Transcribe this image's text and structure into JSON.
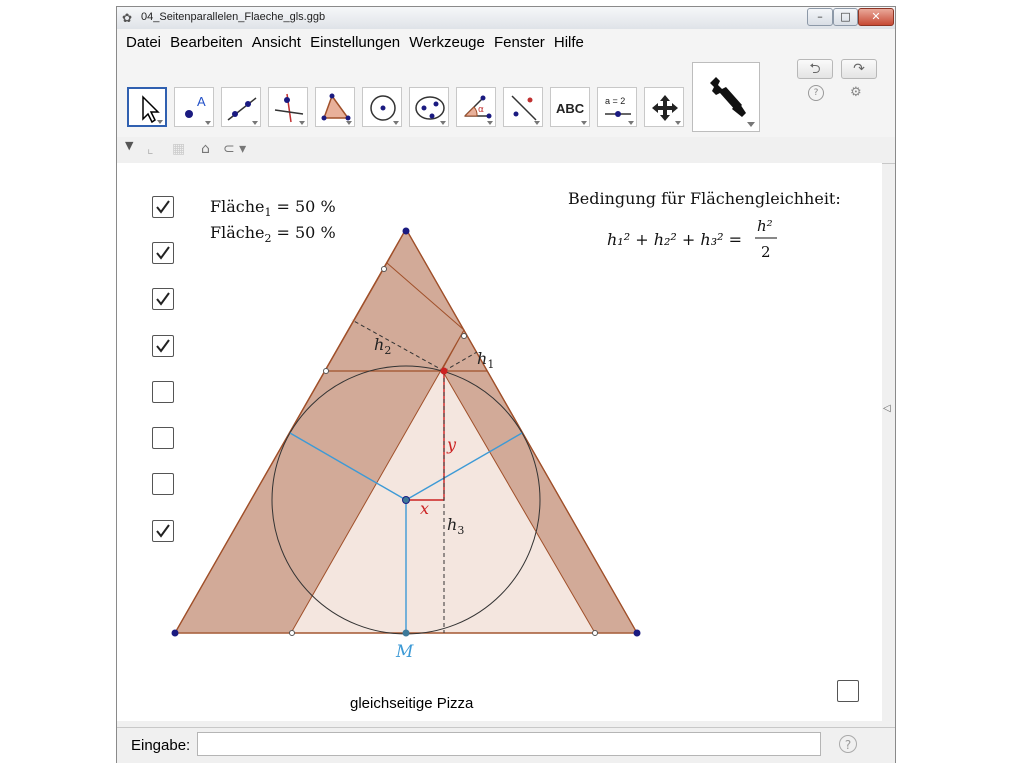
{
  "window": {
    "title": "04_Seitenparallelen_Flaeche_gls.ggb",
    "minimize": "–",
    "maximize": "□",
    "close": "✕"
  },
  "menu": [
    "Datei",
    "Bearbeiten",
    "Ansicht",
    "Einstellungen",
    "Werkzeuge",
    "Fenster",
    "Hilfe"
  ],
  "tools": [
    {
      "name": "move-tool-icon",
      "selected": true
    },
    {
      "name": "point-tool-icon",
      "label": "A"
    },
    {
      "name": "line-tool-icon"
    },
    {
      "name": "perpendicular-line-tool-icon"
    },
    {
      "name": "polygon-tool-icon"
    },
    {
      "name": "circle-center-point-tool-icon"
    },
    {
      "name": "ellipse-tool-icon"
    },
    {
      "name": "angle-tool-icon",
      "label": "α"
    },
    {
      "name": "reflect-tool-icon"
    },
    {
      "name": "text-tool-icon",
      "label": "ABC"
    },
    {
      "name": "slider-tool-icon",
      "label": "a = 2"
    },
    {
      "name": "move-graphics-view-tool-icon"
    }
  ],
  "toolbar": {
    "big_tool": "wrench-icon",
    "undo": "⮌",
    "redo": "↷",
    "help": "?",
    "settings": "⚙"
  },
  "checkboxes": [
    true,
    true,
    true,
    true,
    false,
    false,
    false,
    true
  ],
  "extra_checkbox": false,
  "canvas": {
    "area1_label": "Fläche",
    "area1_sub": "1",
    "area1_value": "= 50 %",
    "area2_label": "Fläche",
    "area2_sub": "2",
    "area2_value": "= 50 %",
    "condition_title": "Bedingung für Flächengleichheit:",
    "formula_lhs": "h₁² + h₂² + h₃² =",
    "formula_num": "h²",
    "formula_den": "2",
    "label_h1": "h",
    "label_h1_sub": "1",
    "label_h2": "h",
    "label_h2_sub": "2",
    "label_h3": "h",
    "label_h3_sub": "3",
    "label_x": "x",
    "label_y": "y",
    "label_M": "M",
    "caption": "gleichseitige Pizza"
  },
  "input": {
    "label": "Eingabe:",
    "value": "",
    "help": "?"
  },
  "colors": {
    "fill_dark": "#d2aa98",
    "fill_light": "#f4e6df",
    "edge": "#a0502a",
    "blue": "#3d9ad6",
    "red": "#cc2222",
    "point": "#1a1a80"
  }
}
